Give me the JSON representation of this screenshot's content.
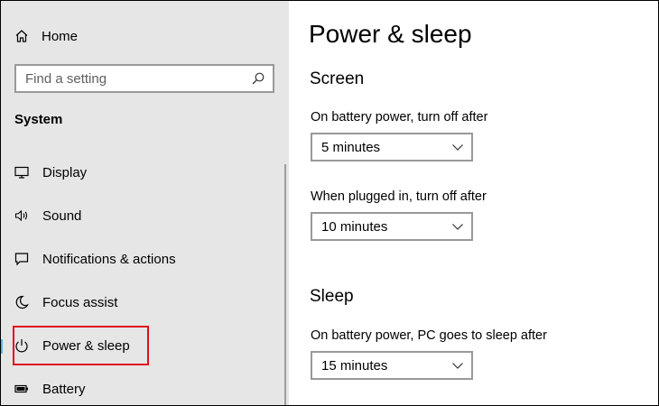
{
  "sidebar": {
    "home_label": "Home",
    "search_placeholder": "Find a setting",
    "section_title": "System",
    "items": [
      {
        "label": "Display",
        "icon": "monitor-icon"
      },
      {
        "label": "Sound",
        "icon": "speaker-icon"
      },
      {
        "label": "Notifications & actions",
        "icon": "notification-icon"
      },
      {
        "label": "Focus assist",
        "icon": "moon-icon"
      },
      {
        "label": "Power & sleep",
        "icon": "power-icon",
        "selected": true
      },
      {
        "label": "Battery",
        "icon": "battery-icon"
      }
    ],
    "highlight_color": "#e0101a",
    "selected_accent": "#4fb7e8"
  },
  "main": {
    "title": "Power & sleep",
    "screen": {
      "heading": "Screen",
      "battery_label": "On battery power, turn off after",
      "battery_value": "5 minutes",
      "plugged_label": "When plugged in, turn off after",
      "plugged_value": "10 minutes"
    },
    "sleep": {
      "heading": "Sleep",
      "battery_label": "On battery power, PC goes to sleep after",
      "battery_value": "15 minutes"
    }
  }
}
